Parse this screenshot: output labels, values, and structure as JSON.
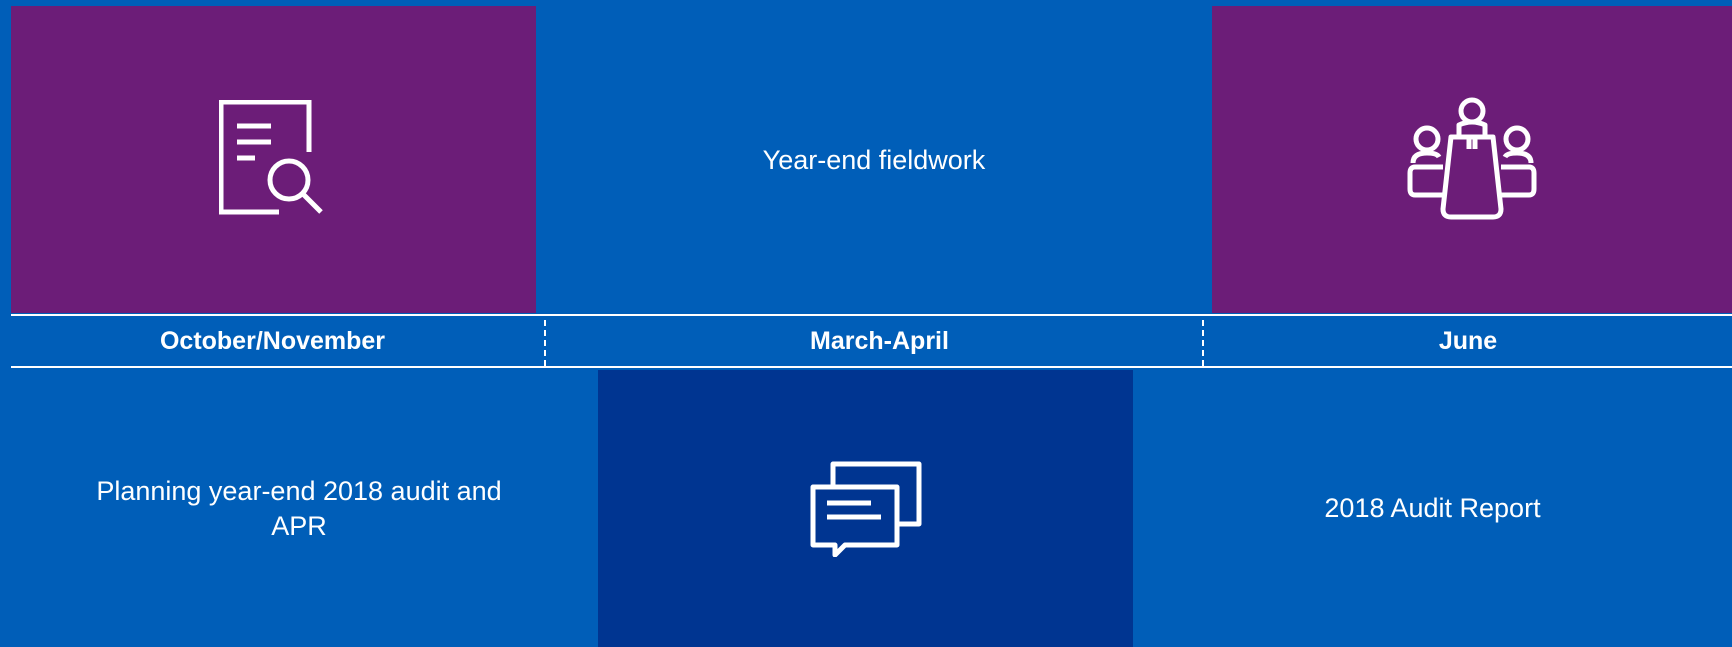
{
  "top": {
    "left_icon": "document-search-icon",
    "middle_text": "Year-end fieldwork",
    "right_icon": "meeting-table-icon"
  },
  "timeline": {
    "labels": [
      "October/November",
      "March-April",
      "June"
    ]
  },
  "bottom": {
    "left_text": "Planning year-end 2018 audit and APR",
    "middle_icon": "chat-bubbles-icon",
    "right_text": "2018 Audit Report"
  },
  "colors": {
    "purple": "#6C1D78",
    "blue": "#005EB8",
    "dark_blue": "#003591",
    "white": "#FFFFFF"
  }
}
